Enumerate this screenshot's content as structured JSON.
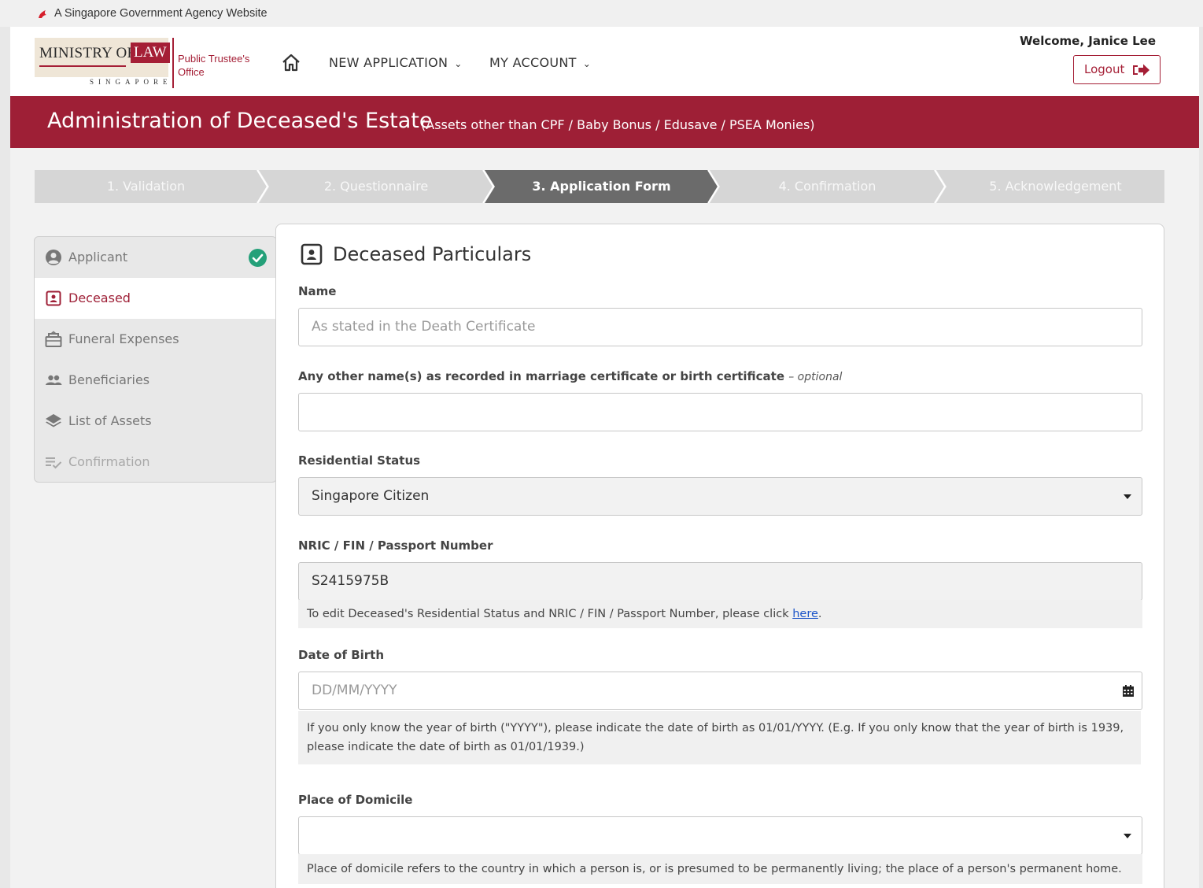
{
  "gov_banner": "A Singapore Government Agency Website",
  "logo": {
    "ministry": "MINISTRY OF",
    "law": "LAW",
    "singapore": "SINGAPORE",
    "office": [
      "Public Trustee's",
      "Office"
    ]
  },
  "nav": {
    "new_application": "NEW APPLICATION",
    "my_account": "MY ACCOUNT"
  },
  "user": {
    "welcome": "Welcome, Janice Lee",
    "logout": "Logout"
  },
  "banner": {
    "title": "Administration of Deceased's Estate",
    "subtitle": "(Assets other than CPF / Baby Bonus / Edusave / PSEA Monies)"
  },
  "steps": [
    {
      "label": "1. Validation",
      "state": "inactive"
    },
    {
      "label": "2. Questionnaire",
      "state": "inactive"
    },
    {
      "label": "3. Application Form",
      "state": "active"
    },
    {
      "label": "4. Confirmation",
      "state": "inactive"
    },
    {
      "label": "5. Acknowledgement",
      "state": "inactive"
    }
  ],
  "sidebar": {
    "items": [
      {
        "label": "Applicant",
        "icon": "user-circle-icon",
        "completed": true
      },
      {
        "label": "Deceased",
        "icon": "id-card-icon",
        "current": true
      },
      {
        "label": "Funeral Expenses",
        "icon": "funeral-icon"
      },
      {
        "label": "Beneficiaries",
        "icon": "people-icon"
      },
      {
        "label": "List of Assets",
        "icon": "layers-icon"
      },
      {
        "label": "Confirmation",
        "icon": "checklist-icon",
        "disabled": true
      }
    ]
  },
  "form": {
    "title": "Deceased Particulars",
    "name": {
      "label": "Name",
      "placeholder": "As stated in the Death Certificate",
      "value": ""
    },
    "other_names": {
      "label": "Any other name(s) as recorded in marriage certificate or birth certificate",
      "optional": "– optional",
      "value": ""
    },
    "residential_status": {
      "label": "Residential Status",
      "value": "Singapore Citizen"
    },
    "nric": {
      "label": "NRIC / FIN / Passport Number",
      "value": "S2415975B",
      "hint_prefix": "To edit Deceased's Residential Status and NRIC / FIN / Passport Number, please click ",
      "hint_link": "here",
      "hint_suffix": "."
    },
    "dob": {
      "label": "Date of Birth",
      "placeholder": "DD/MM/YYYY",
      "hint": "If you only know the year of birth (\"YYYY\"), please indicate the date of birth as 01/01/YYYY. (E.g. If you only know that the year of birth is 1939, please indicate the date of birth as 01/01/1939.)"
    },
    "domicile": {
      "label": "Place of Domicile",
      "value": "",
      "hint": "Place of domicile refers to the country in which a person is, or is presumed to be permanently living; the place of a person's permanent home."
    }
  },
  "colors": {
    "brand": "#9e1f36",
    "step_active": "#6b6b6b",
    "step_inactive": "#d6d6d6",
    "success": "#24a079",
    "link": "#1a53c8"
  }
}
